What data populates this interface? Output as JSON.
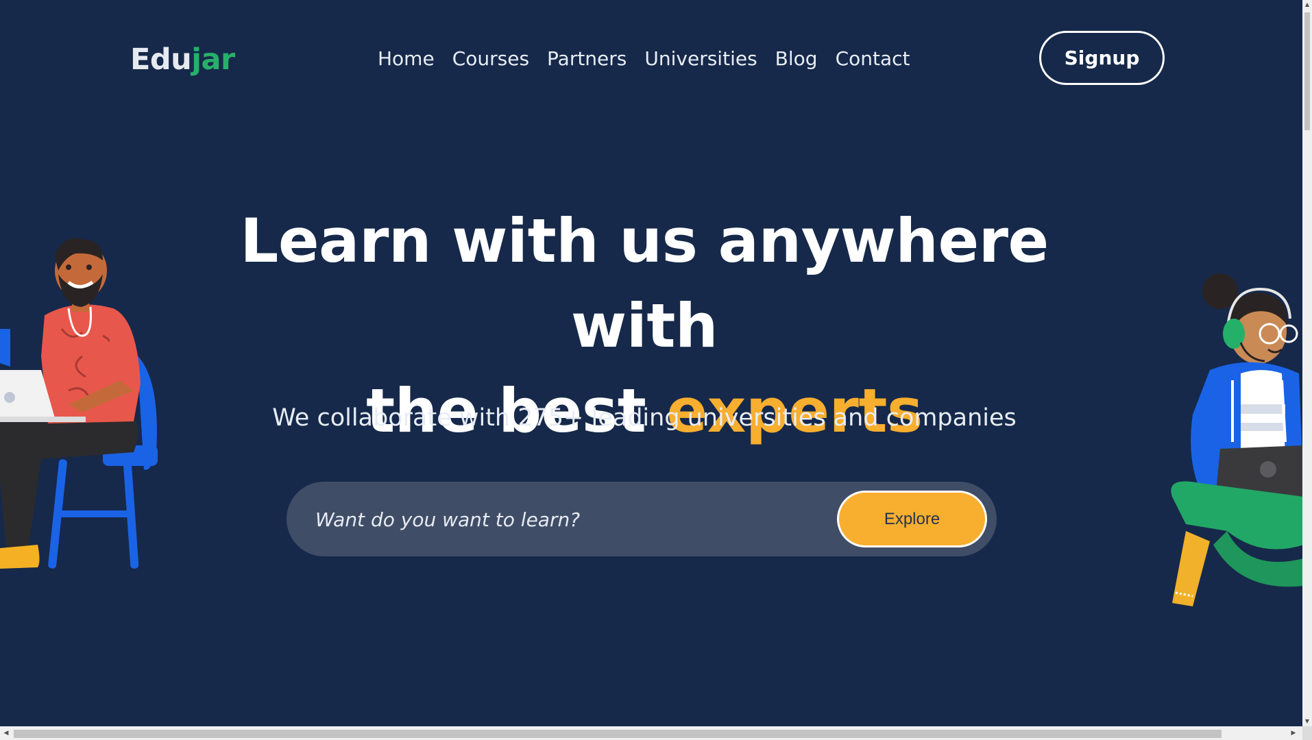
{
  "header": {
    "logo_part1": "Edu",
    "logo_part2": "jar",
    "nav": [
      "Home",
      "Courses",
      "Partners",
      "Universities",
      "Blog",
      "Contact"
    ],
    "signup_label": "Signup"
  },
  "hero": {
    "title_line1": "Learn with us anywhere with",
    "title_line2_prefix": "the best ",
    "title_line2_accent": "experts",
    "subtitle": "We collaborate with 275+ leading universities and companies"
  },
  "search": {
    "placeholder": "Want do you want to learn?",
    "button_label": "Explore"
  },
  "icons": {
    "scroll_up": "▲",
    "scroll_down": "▼",
    "scroll_left": "◀",
    "scroll_right": "▶"
  },
  "colors": {
    "background": "#16294a",
    "accent": "#f8ae2e",
    "logo_green": "#27b069",
    "search_bg": "#404d66"
  }
}
